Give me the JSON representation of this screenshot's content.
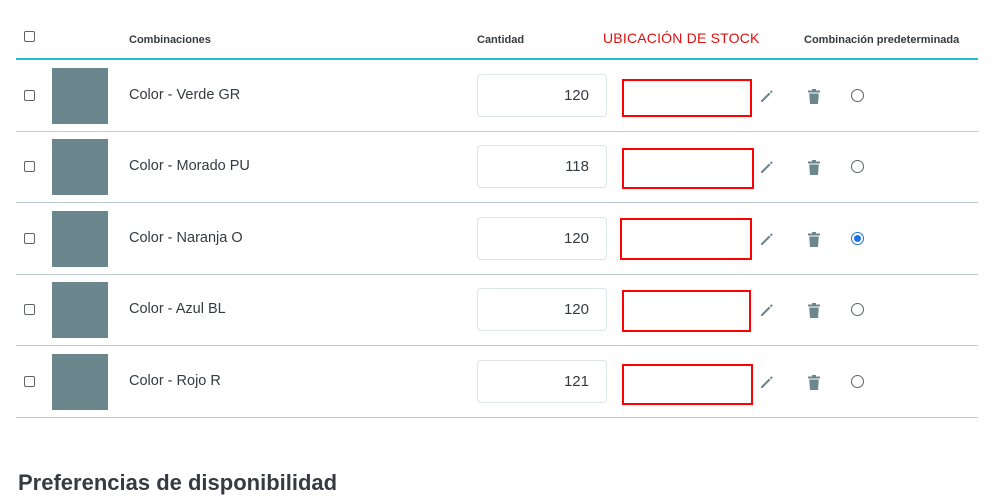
{
  "header": {
    "combinations_label": "Combinaciones",
    "quantity_label": "Cantidad",
    "stock_location_label": "UBICACIÓN DE STOCK",
    "default_label": "Combinación predeterminada"
  },
  "rows": [
    {
      "name": "Color - Verde GR",
      "quantity": "120",
      "is_default": false
    },
    {
      "name": "Color - Morado PU",
      "quantity": "118",
      "is_default": false
    },
    {
      "name": "Color - Naranja O",
      "quantity": "120",
      "is_default": true
    },
    {
      "name": "Color - Azul BL",
      "quantity": "120",
      "is_default": false
    },
    {
      "name": "Color - Rojo R",
      "quantity": "121",
      "is_default": false
    }
  ],
  "availability": {
    "title": "Preferencias de disponibilidad"
  },
  "colors": {
    "accent_header_line": "#25b9d7",
    "thumbnail": "#6c868e",
    "annotation_red": "#ff0000",
    "radio_selected": "#1a73e8"
  },
  "icons": {
    "edit": "pencil-icon",
    "delete": "trash-icon"
  }
}
